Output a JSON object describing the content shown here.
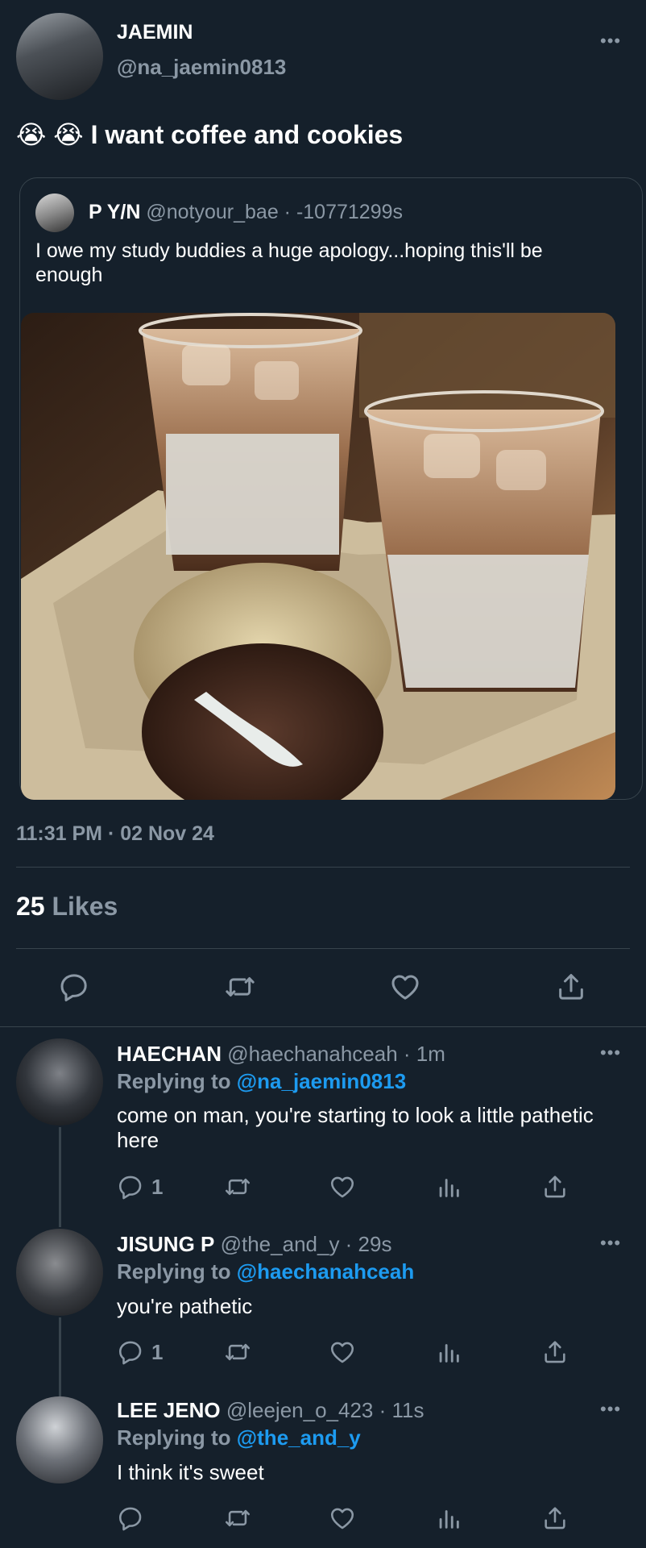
{
  "main_tweet": {
    "display_name": "JAEMIN",
    "handle": "@na_jaemin0813",
    "text": "😭 😭 I want coffee and cookies",
    "timestamp": "11:31 PM · 02 Nov 24",
    "likes_count": "25",
    "likes_label": "Likes",
    "more_label": "•••"
  },
  "quoted_tweet": {
    "display_name": "P Y/N",
    "handle_time": "@notyour_bae · -10771299s",
    "text": "I owe my study buddies a huge apology...hoping this'll be enough"
  },
  "actions": [
    "reply-icon",
    "retweet-icon",
    "like-icon",
    "share-icon"
  ],
  "replies": [
    {
      "display_name": "HAECHAN",
      "handle_time": "@haechanahceah · 1m",
      "replying_prefix": "Replying to",
      "replying_to": "@na_jaemin0813",
      "text": "come on man, you're starting to look a little pathetic here",
      "reply_count": "1",
      "more_label": "•••"
    },
    {
      "display_name": "JISUNG P",
      "handle_time": "@the_and_y · 29s",
      "replying_prefix": "Replying to",
      "replying_to": "@haechanahceah",
      "text": "you're pathetic",
      "reply_count": "1",
      "more_label": "•••"
    },
    {
      "display_name": "LEE JENO",
      "handle_time": "@leejen_o_423 · 11s",
      "replying_prefix": "Replying to",
      "replying_to": "@the_and_y",
      "text": "I think it's sweet",
      "reply_count": "",
      "more_label": "•••"
    }
  ],
  "colors": {
    "background": "#15202b",
    "divider": "#38444d",
    "muted_text": "#8b98a5",
    "link": "#1d9bf0"
  }
}
